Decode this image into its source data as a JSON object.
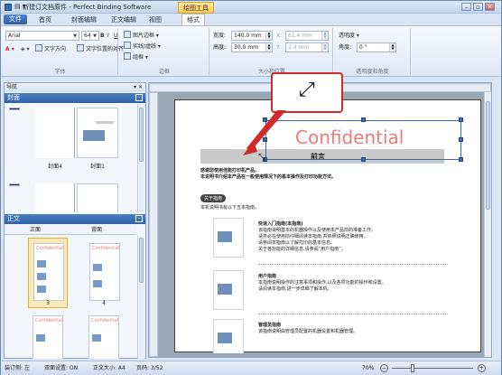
{
  "titlebar": {
    "qa": "▤ ▾",
    "title": "新建订文档原件 - Perfect Binding Software",
    "context_tab": "绘图工具",
    "controls": [
      "–",
      "▫",
      "✕"
    ]
  },
  "menu": {
    "file_label": "文件",
    "tabs": [
      "首页",
      "封面编辑",
      "正文编辑",
      "视图",
      "格式"
    ],
    "active_tab": "格式"
  },
  "ribbon": {
    "font": {
      "name": "Arial",
      "size": "64",
      "bold": "B",
      "italic": "I",
      "underline": "U",
      "direction": "文字方向",
      "align": "文字位置的对齐",
      "label": "字体"
    },
    "border": {
      "image_border": "图片边框",
      "line": "实线/虚线",
      "group": "组框",
      "label": "边框"
    },
    "size": {
      "width_label": "宽度:",
      "width_value": "140.0 mm",
      "height_label": "高度:",
      "height_value": "30.0 mm",
      "x_label": "X:",
      "x_value": "61.4 mm",
      "y_label": "Y:",
      "y_value": "2.4 mm",
      "label": "大小和位置"
    },
    "transp": {
      "opacity": "透明度",
      "angle_label": "角度:",
      "angle_value": "0 °",
      "label": "透明度和角度"
    }
  },
  "nav": {
    "title": "导航",
    "pin": "▾ ✕",
    "cover": {
      "title": "封面",
      "pages": [
        "封面4",
        "封面1"
      ]
    },
    "body": {
      "title": "正文",
      "columns": [
        "正面",
        "背面"
      ],
      "pages": [
        "3",
        "4"
      ]
    },
    "page_badge": "Confidential"
  },
  "document": {
    "watermark": "Confidential",
    "heading": "前言",
    "intro": [
      "感谢您使用佳能打印机产品。",
      "本说明书介绍本产品在一般使用情况下的基本操作及打印功能方法。"
    ],
    "section": "关于指南",
    "section_sub": "本机说明书有以下五本指南。",
    "items": [
      {
        "title": "快速入门指南(本指南)",
        "lines": [
          "该指南说明基本的机器操作以及使用本产品前的准备工作。",
          "请务必在使用前仔细阅读本指南,并依照说明正确使用。",
          "请参阅本指南以了解打印的基本信息。",
          "关于各功能的详细信息,请参阅“用户指南”。"
        ]
      },
      {
        "title": "用户指南",
        "lines": [
          "本指南说明操作的注意事项和操作,以及各项功能的操作和设置。",
          "请阅读本指南,进一步详细了解本机。"
        ]
      },
      {
        "title": "管理员指南",
        "lines": [
          "该指南说明由管理员配置的机器设置和机器管理。"
        ]
      }
    ]
  },
  "status": {
    "binding": "装订侧: 左",
    "duplex": "双面设置: ON",
    "body_size": "正文大小: A4",
    "pages": "页码: 3/52",
    "zoom": "70%",
    "zoom_minus": "−",
    "zoom_plus": "+"
  },
  "colors": {
    "accent": "#2e61a6",
    "context": "#f8cf53",
    "callout": "#d02a2a",
    "watermark": "#e87c7c"
  }
}
